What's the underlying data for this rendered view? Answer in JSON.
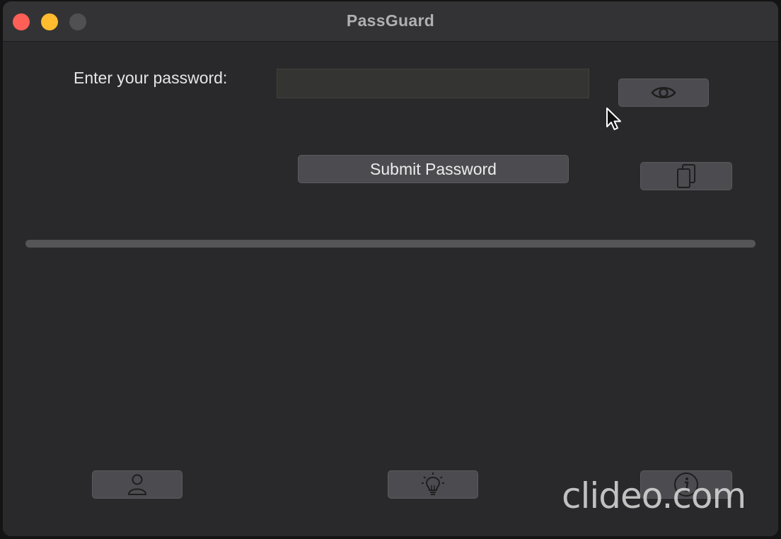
{
  "window": {
    "title": "PassGuard"
  },
  "form": {
    "prompt_label": "Enter your password:",
    "password_value": "",
    "password_placeholder": "",
    "submit_label": "Submit Password"
  },
  "progress": {
    "value": 0
  },
  "icons": {
    "show_password": "eye-icon",
    "copy": "copy-icon",
    "account": "user-icon",
    "tips": "lightbulb-icon",
    "about": "info-icon"
  },
  "watermark": {
    "text": "clideo.com"
  },
  "colors": {
    "close": "#fe5f57",
    "minimize": "#febc2e",
    "zoom": "#505052",
    "background": "#2b2b2d",
    "button": "#4c4b50"
  }
}
